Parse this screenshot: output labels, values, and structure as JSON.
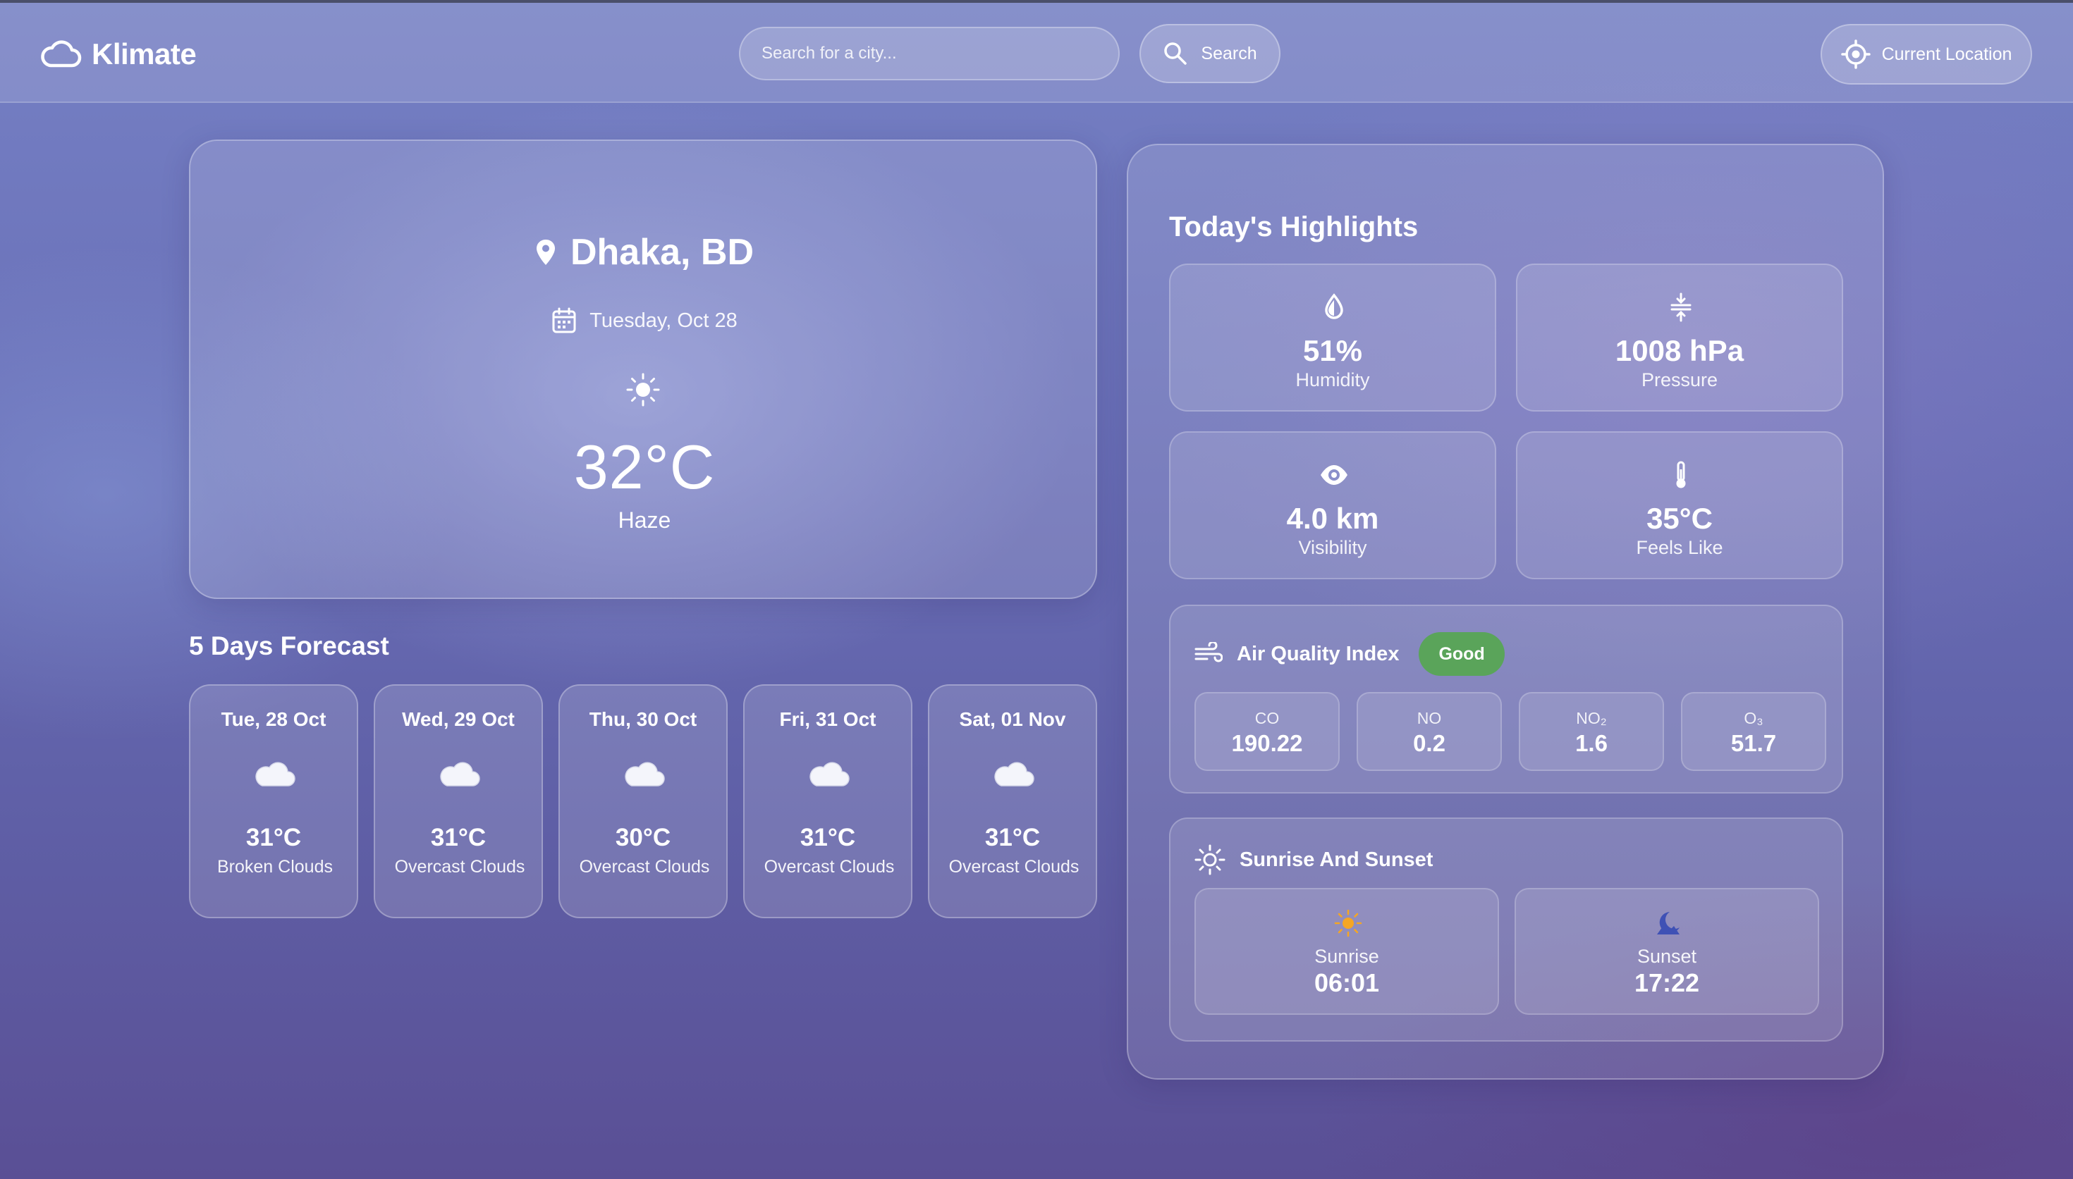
{
  "app": {
    "name": "Klimate"
  },
  "header": {
    "search_placeholder": "Search for a city...",
    "search_label": "Search",
    "location_label": "Current Location"
  },
  "current": {
    "city": "Dhaka, BD",
    "date": "Tuesday, Oct 28",
    "temperature": "32°C",
    "condition": "Haze",
    "icon": "sun-icon"
  },
  "forecast": {
    "title": "5 Days Forecast",
    "days": [
      {
        "date": "Tue, 28 Oct",
        "temp": "31°C",
        "desc": "Broken Clouds",
        "icon": "cloud-icon"
      },
      {
        "date": "Wed, 29 Oct",
        "temp": "31°C",
        "desc": "Overcast Clouds",
        "icon": "cloud-icon"
      },
      {
        "date": "Thu, 30 Oct",
        "temp": "30°C",
        "desc": "Overcast Clouds",
        "icon": "cloud-icon"
      },
      {
        "date": "Fri, 31 Oct",
        "temp": "31°C",
        "desc": "Overcast Clouds",
        "icon": "cloud-icon"
      },
      {
        "date": "Sat, 01 Nov",
        "temp": "31°C",
        "desc": "Overcast Clouds",
        "icon": "cloud-icon"
      }
    ]
  },
  "highlights": {
    "title": "Today's Highlights",
    "cards": [
      {
        "value": "51%",
        "label": "Humidity",
        "icon": "droplet-icon"
      },
      {
        "value": "1008 hPa",
        "label": "Pressure",
        "icon": "pressure-icon"
      },
      {
        "value": "4.0 km",
        "label": "Visibility",
        "icon": "eye-icon"
      },
      {
        "value": "35°C",
        "label": "Feels Like",
        "icon": "thermometer-icon"
      }
    ],
    "air_quality": {
      "title": "Air Quality Index",
      "status": "Good",
      "status_color": "#5aa45a",
      "pollutants": [
        {
          "name": "CO",
          "value": "190.22"
        },
        {
          "name": "NO",
          "value": "0.2"
        },
        {
          "name": "NO₂",
          "value": "1.6"
        },
        {
          "name": "O₃",
          "value": "51.7"
        }
      ]
    },
    "sun": {
      "title": "Sunrise And Sunset",
      "sunrise_label": "Sunrise",
      "sunrise_time": "06:01",
      "sunset_label": "Sunset",
      "sunset_time": "17:22",
      "sunrise_color": "#f5a623",
      "sunset_color": "#3f51b5"
    }
  }
}
